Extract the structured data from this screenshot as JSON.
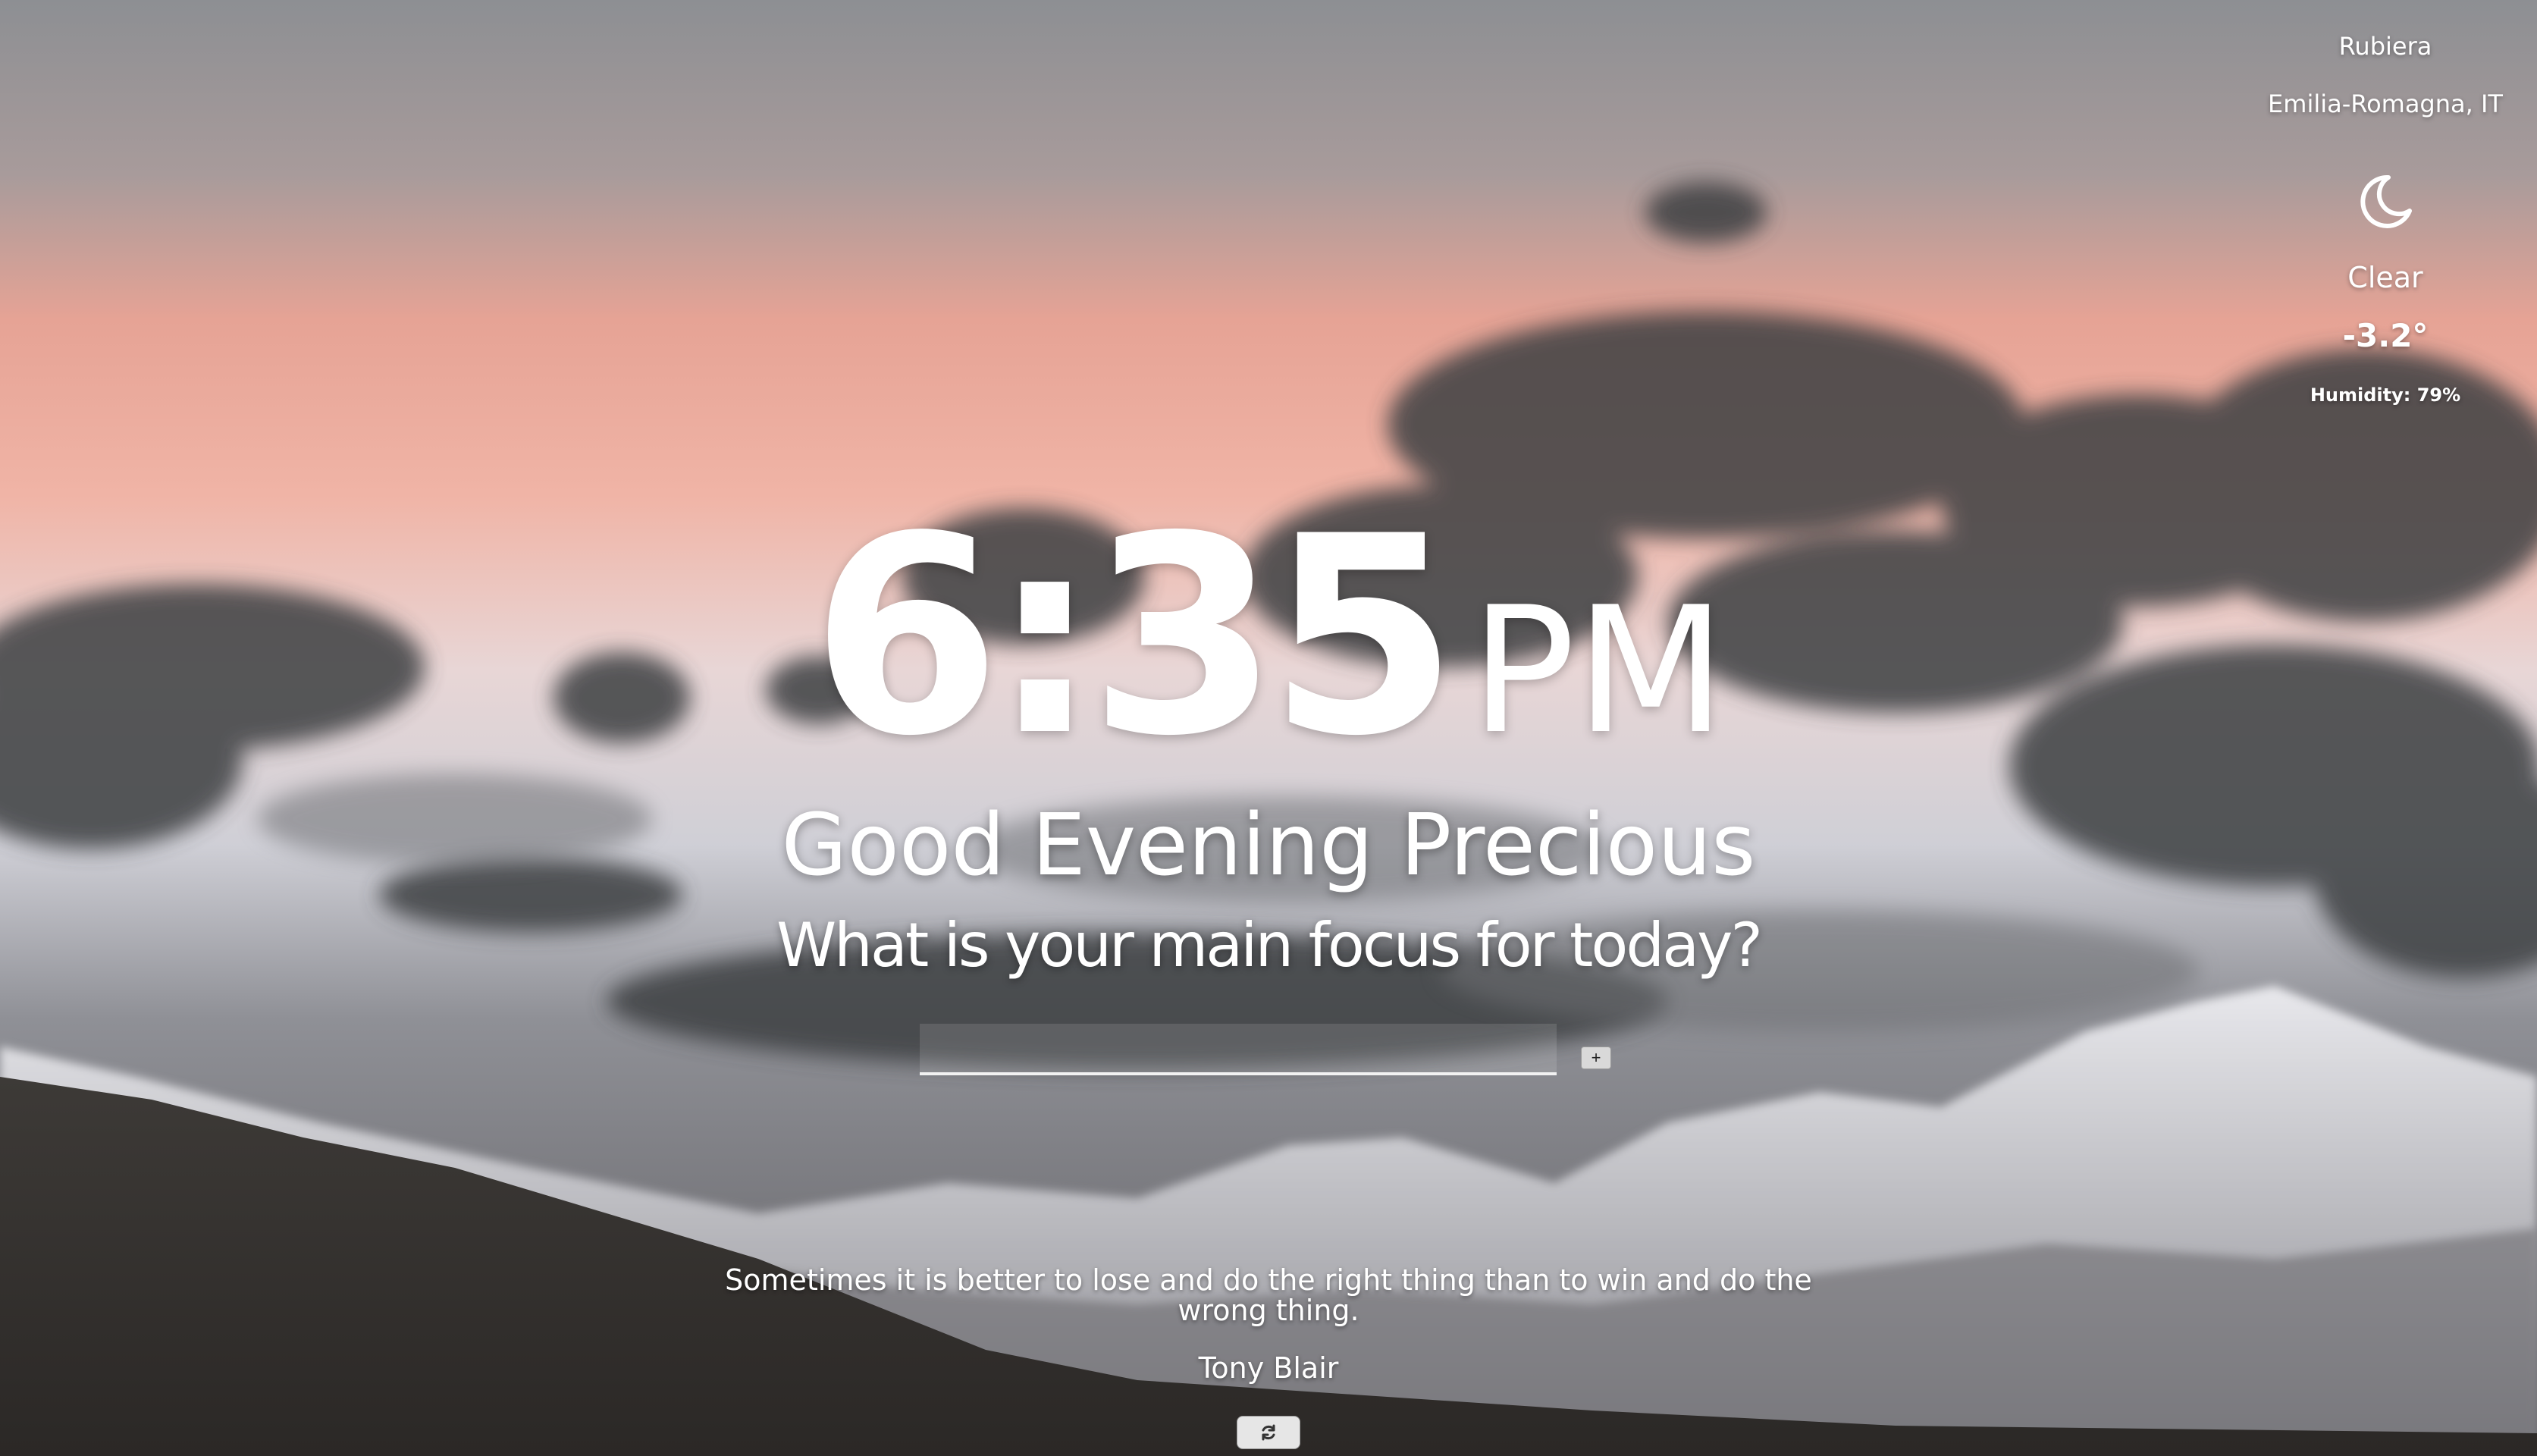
{
  "weather": {
    "city": "Rubiera",
    "region": "Emilia-Romagna, IT",
    "icon": "crescent-moon-icon",
    "condition": "Clear",
    "temperature": "-3.2°",
    "humidity": "Humidity: 79%"
  },
  "clock": {
    "time": "6:35",
    "ampm": "PM"
  },
  "greeting": "Good Evening Precious",
  "focus": {
    "question": "What is your main focus for today?",
    "input_value": "",
    "add_label": "+"
  },
  "quote": {
    "text": "Sometimes it is better to lose and do the right thing than to win and do the wrong thing.",
    "author": "Tony Blair",
    "refresh_icon": "refresh-icon"
  }
}
